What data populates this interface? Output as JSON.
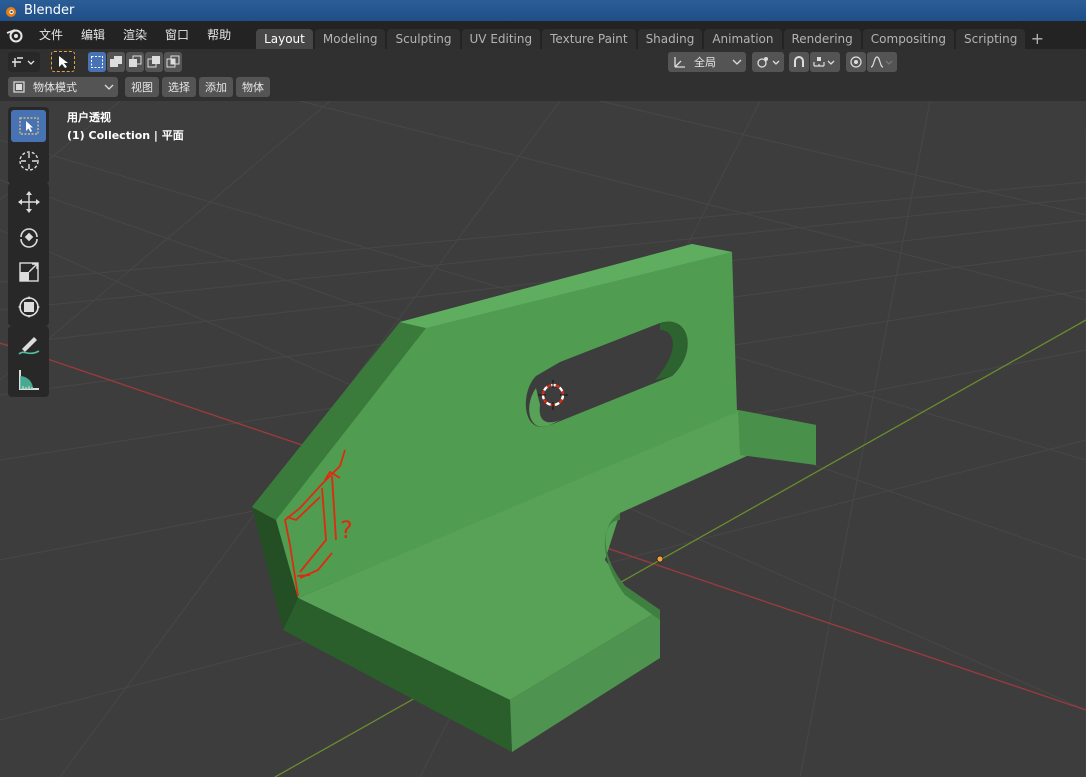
{
  "window": {
    "title": "Blender"
  },
  "menu": [
    "文件",
    "编辑",
    "渲染",
    "窗口",
    "帮助"
  ],
  "workspaces": {
    "active": "Layout",
    "tabs": [
      "Layout",
      "Modeling",
      "Sculpting",
      "UV Editing",
      "Texture Paint",
      "Shading",
      "Animation",
      "Rendering",
      "Compositing",
      "Scripting"
    ]
  },
  "header": {
    "transform_orientation": "全局",
    "mode": "物体模式",
    "view_menu": "视图",
    "select_menu": "选择",
    "add_menu": "添加",
    "object_menu": "物体"
  },
  "viewport": {
    "view_name": "用户透视",
    "collection_info": "(1) Collection | 平面",
    "object_color": "#57a257",
    "annotation_color": "#e02a10",
    "annotation_text": "?"
  },
  "tools": [
    "select-box-icon",
    "cursor-icon",
    "move-icon",
    "rotate-icon",
    "scale-icon",
    "transform-icon",
    "annotate-icon",
    "measure-icon"
  ],
  "colors": {
    "active_blue": "#4772b3",
    "x_axis": "#9d3a3f",
    "y_axis": "#6a8c2b"
  }
}
